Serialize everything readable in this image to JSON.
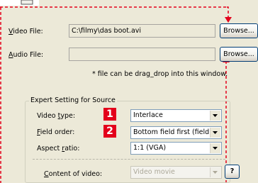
{
  "fields": {
    "video": {
      "label": "Video File:",
      "value": "C:\\filmy\\das boot.avi",
      "button": "Browse..."
    },
    "audio": {
      "label": "Audio File:",
      "value": "",
      "button": "Browse..."
    }
  },
  "drag_hint": "* file can be drag_drop into this window.",
  "expert": {
    "title": "Expert Setting for Source",
    "video_type": {
      "label": "Video type:",
      "value": "Interlace",
      "badge": "1"
    },
    "field_order": {
      "label": "Field order:",
      "value": "Bottom field first (field B)",
      "badge": "2"
    },
    "aspect_ratio": {
      "label": "Aspect ratio:",
      "value": "1:1 (VGA)"
    },
    "content": {
      "label": "Content of video:",
      "value": "Video movie"
    },
    "help_button": "?"
  },
  "colors": {
    "callout": "#e3001b",
    "window": "#ece9d8",
    "field_border": "#7f9db9"
  }
}
